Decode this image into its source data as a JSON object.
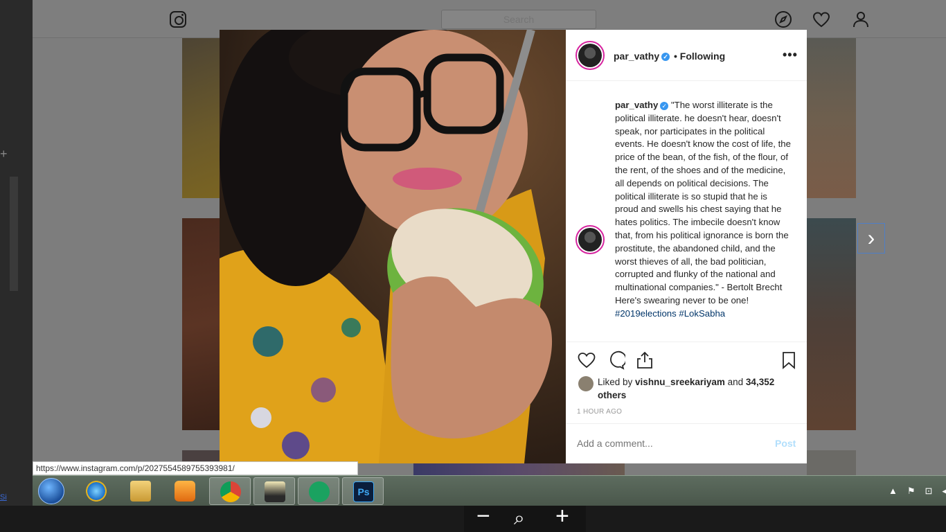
{
  "instagram": {
    "search_placeholder": "Search"
  },
  "post": {
    "username": "par_vathy",
    "follow_status": "Following",
    "more_label": "•••",
    "separator": "•",
    "caption_username": "par_vathy",
    "caption_text": "\"The worst illiterate is the political illiterate. he doesn't hear, doesn't speak, nor participates in the political events. He doesn't know the cost of life, the price of the bean, of the fish, of the flour, of the rent, of the shoes and of the medicine, all depends on political decisions. The political illiterate is so stupid that he is proud and swells his chest saying that he hates politics. The imbecile doesn't know that, from his political ignorance is born the prostitute, the abandoned child, and the worst thieves of all, the bad politician, corrupted and flunky of the national and multinational companies.\" - Bertolt Brecht",
    "caption_line2": "Here's swearing never to be one!",
    "caption_tags": "#2019elections #LokSabha",
    "liked_prefix": "Liked by ",
    "liked_user": "vishnu_sreekariyam",
    "liked_and": " and ",
    "liked_others": "34,352 others",
    "timestamp": "1 HOUR AGO",
    "comment_placeholder": "Add a comment...",
    "post_button": "Post"
  },
  "browser": {
    "status_url": "https://www.instagram.com/p/2027554589755393981/"
  },
  "taskbar": {
    "items": [
      "internet-explorer",
      "file-explorer",
      "media-player",
      "chrome",
      "typewriter-app",
      "hangouts",
      "photoshop"
    ],
    "photoshop_label": "Ps"
  },
  "zoom_controls": {
    "minus": "−",
    "zoom": "⌕",
    "plus": "+"
  },
  "colors": {
    "verified": "#3897f0",
    "post_button_disabled": "#b2dffc",
    "hashtag": "#003569"
  }
}
